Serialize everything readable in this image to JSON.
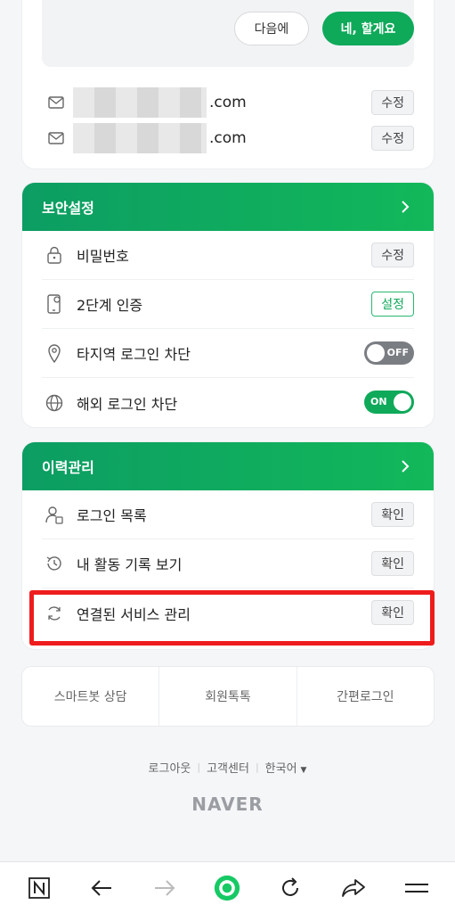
{
  "prompt": {
    "later_label": "다음에",
    "yes_label": "네, 할게요"
  },
  "emails": [
    {
      "domain": ".com",
      "edit_label": "수정"
    },
    {
      "domain": ".com",
      "edit_label": "수정"
    }
  ],
  "security": {
    "title": "보안설정",
    "items": [
      {
        "label": "비밀번호",
        "action": "수정"
      },
      {
        "label": "2단계 인증",
        "action": "설정"
      },
      {
        "label": "타지역 로그인 차단",
        "toggle": "OFF"
      },
      {
        "label": "해외 로그인 차단",
        "toggle": "ON"
      }
    ]
  },
  "history": {
    "title": "이력관리",
    "items": [
      {
        "label": "로그인 목록",
        "action": "확인"
      },
      {
        "label": "내 활동 기록 보기",
        "action": "확인"
      },
      {
        "label": "연결된 서비스 관리",
        "action": "확인"
      }
    ]
  },
  "quick_links": [
    "스마트봇 상담",
    "회원톡톡",
    "간편로그인"
  ],
  "footer": {
    "logout": "로그아웃",
    "help": "고객센터",
    "language": "한국어",
    "brand": "NAVER"
  },
  "colors": {
    "accent": "#0fa95a",
    "highlight": "#ee1c1c"
  }
}
